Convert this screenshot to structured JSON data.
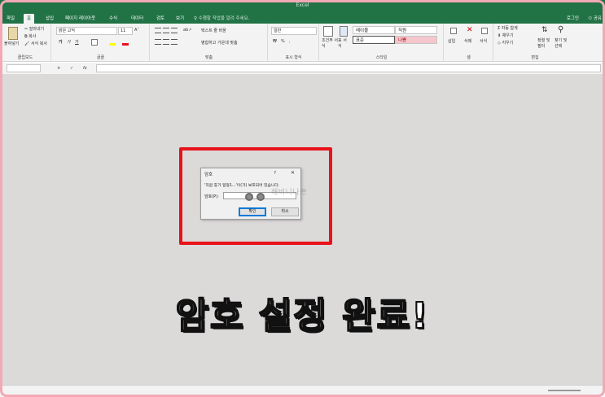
{
  "window": {
    "title": "Excel"
  },
  "tabs": [
    "파일",
    "홈",
    "삽입",
    "페이지 레이아웃",
    "수식",
    "데이터",
    "검토",
    "보기"
  ],
  "tell_me": "♀ 수행할 작업을 알려 주세요.",
  "sign_in": "로그인",
  "share": "공유",
  "ribbon": {
    "clipboard": {
      "label": "클립보드",
      "paste": "붙여넣기",
      "cut": "잘라내기",
      "copy": "복사",
      "format_painter": "서식 복사"
    },
    "font": {
      "label": "글꼴",
      "name": "맑은 고딕",
      "size": "11",
      "bold": "가",
      "italic": "가",
      "underline": "가"
    },
    "alignment": {
      "label": "맞춤",
      "wrap": "텍스트 줄 바꿈",
      "merge": "병합하고 가운데 맞춤"
    },
    "number": {
      "label": "표시 형식",
      "format": "일반",
      "percent": "%",
      "comma": ","
    },
    "styles": {
      "label": "스타일",
      "conditional": "조건부 서식",
      "table": "표 서식",
      "cells": [
        "레이블",
        "직원",
        "표준",
        "나쁨"
      ]
    },
    "cells": {
      "label": "셀",
      "insert": "삽입",
      "delete": "삭제",
      "format": "서식"
    },
    "editing": {
      "label": "편집",
      "autosum": "자동 합계",
      "fill": "채우기",
      "clear": "지우기",
      "sort": "정렬 및 필터",
      "find": "찾기 및 선택"
    }
  },
  "formula_bar": {
    "cancel": "×",
    "enter": "✓",
    "fx": "fx",
    "value": ""
  },
  "dialog": {
    "title": "암호",
    "help": "?",
    "close": "✕",
    "message": "'직원 휴가 일정1...'이(가) 보호되어 있습니다.",
    "password_label": "암호(P):",
    "ok": "확인",
    "cancel": "취소"
  },
  "watermark": "해비니나쁘",
  "caption": "암호 설정 완료!",
  "colors": {
    "excel_green": "#217346",
    "highlight": "#e8131a",
    "frame": "#f2a9b5",
    "workspace": "#dcd9d9"
  }
}
